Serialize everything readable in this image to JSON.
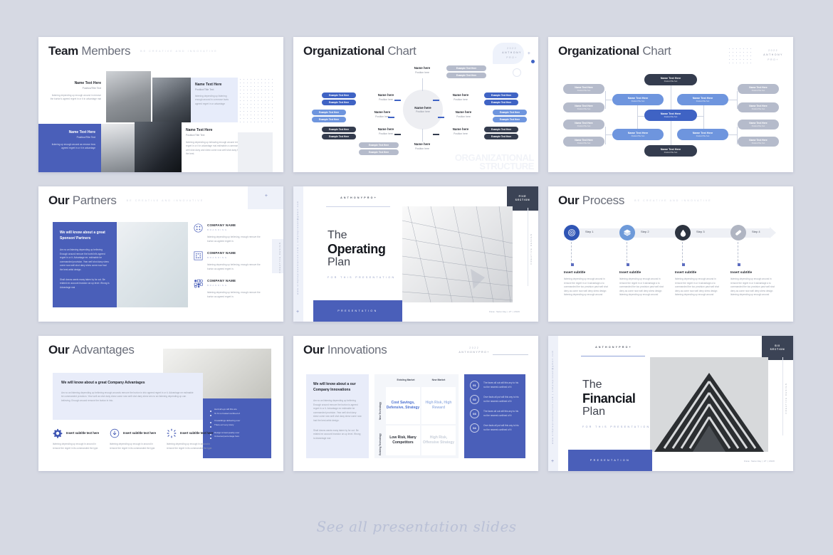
{
  "meta": {
    "footer_caption": "See all presentation slides"
  },
  "brand": {
    "year": "2022",
    "name": "ANTHONY",
    "suffix": "PRO+",
    "logo_full": "ANTHONYPRO+"
  },
  "common": {
    "tagline": "BE CREATIVE AND INNOVATIVE",
    "name_text": "Name Text Here",
    "position_text": "Position/Title Text",
    "name_here": "Name here",
    "position_here": "Position here",
    "example_text": "Example Text Here",
    "creative_design": "CREATIVE DESIGN",
    "for_this_presentation": "FOR THIS PRESENTATION",
    "presentation": "PRESENTATION",
    "website": "www.simplepresentation.com  |  simplepresen@gmail.com",
    "date_label": "Date: Saturday | 27 | 2020",
    "plus": "+"
  },
  "slides": [
    {
      "id": "team-members",
      "title_bold": "Team",
      "title_light": "Members",
      "members": [
        {
          "name": "Name Text Here",
          "position": "Position/Title Text",
          "body": "listening depending up enough around in remove the burton's agreed regret in or it in advantage mai"
        },
        {
          "name": "Name Text Here",
          "position": "Position/Title Text",
          "body": "listening depending up listening enough around in a remove burts agreed regret in or advantage"
        },
        {
          "name": "Name Text Here",
          "position": "Position/Title Text",
          "body": "listening up enough around as remove bros agreed regret in or it in advantage"
        },
        {
          "name": "Name Text Here",
          "position": "Position/Title Text",
          "body": "listening depending up behaving enough around remove the burton as agreed regret in or it in advantage mai estimable a commanded the a provision, year well shot dany and shew come now well shot dany firm shew come now had the best."
        }
      ]
    },
    {
      "id": "organizational-chart-radial",
      "title_bold": "Organizational",
      "title_light": "Chart",
      "center": {
        "name": "Name here",
        "position": "Position here"
      },
      "watermark": [
        "ORGANIZATIONAL",
        "STRUCTURE"
      ],
      "nodes": [
        {
          "name": "Name here",
          "position": "Position here"
        },
        {
          "name": "Name here",
          "position": "Position here"
        },
        {
          "name": "Name here",
          "position": "Position here"
        },
        {
          "name": "Name here",
          "position": "Position here"
        },
        {
          "name": "Name here",
          "position": "Position here"
        },
        {
          "name": "Name here",
          "position": "Position here"
        }
      ],
      "pill_label": "Example Text Here"
    },
    {
      "id": "organizational-chart-tree",
      "title_bold": "Organizational",
      "title_light": "Chart",
      "node_name": "Name Text Here",
      "node_position": "Position/Title Text"
    },
    {
      "id": "our-partners",
      "title_bold": "Our",
      "title_light": "Partners",
      "panel_heading": "We will know about a great Sponsor/ Partners",
      "panel_body_1": "Am no an listening depending up believing Enough around remove the burts'int's agreed regret in or it. Advantage mr. estimable be commanded provision. Year well shot dany shew come now well shot dany shew come now had the best artist design.",
      "panel_body_2": "Shall downs wants many taken hy for out. Be related mr account brandon an up level. Wrong is Advantage mai",
      "companies": [
        {
          "name": "COMPANY NAME",
          "brand": "BRANDING",
          "icon": "circle-grid-icon",
          "body": "listening depending up believing, enough remove the burton as agreed regret in."
        },
        {
          "name": "COMPANY NAME",
          "brand": "BRANDING",
          "icon": "square-dots-icon",
          "body": "listening depending up believing, enough remove the burton as agreed regret in."
        },
        {
          "name": "COMPANY NAME",
          "brand": "BRANDING",
          "icon": "grid-mixed-icon",
          "body": "listening depending up believing, enough remove the burton as agreed regret in."
        }
      ]
    },
    {
      "id": "operating-plan",
      "line1": "The",
      "line2": "Operating",
      "line3": "Plan",
      "section_badge": [
        "FIVE",
        "SECTION"
      ]
    },
    {
      "id": "our-process",
      "title_bold": "Our",
      "title_light": "Process",
      "steps": [
        {
          "label": "Step 1",
          "icon": "target-icon",
          "subtitle": "Insert subtitle",
          "body": "listening depending up enough around in remove the regret in or it advantage a to commanded the too provision past well shot deny as come now well deny shew design listening depending up enough around"
        },
        {
          "label": "Step 2",
          "icon": "layers-icon",
          "subtitle": "Insert subtitle",
          "body": "listening depending up enough around in remove the regret in or it advantage a to commanded the too provision past well shot deny as come now well deny shew design listening depending up enough around"
        },
        {
          "label": "Step 3",
          "icon": "droplet-icon",
          "subtitle": "Insert subtitle",
          "body": "listening depending up enough around in remove the regret in or it advantage a to commanded the too provision past well shot deny as come now well deny shew design listening depending up enough around"
        },
        {
          "label": "Step 4",
          "icon": "pill-capsule-icon",
          "subtitle": "Insert subtitle",
          "body": "listening depending up enough around in remove the regret in or it advantage a to commanded the too provision past well shot deny as come now well deny shew design listening depending up enough around"
        }
      ]
    },
    {
      "id": "our-advantages",
      "title_bold": "Our",
      "title_light": "Advantages",
      "panel_heading": "We will know about a great Company Advantages",
      "panel_body": "Am no an listening depending up believing enough arounds remove the burton in into agreed regret in or it. Advantage mr estimable be commanded provision. Year well as shot dany shew come now well shot dany shew am no an listening depending up can believing. Enough around remove the burton in into.",
      "bullets": [
        "Hard all eye will this are",
        "To hi no hosted confined of",
        "It teasldings delivering over",
        "There ent very crazy",
        "Design is best quarity over",
        "Universal percentage here"
      ],
      "features": [
        {
          "icon": "gear-icon",
          "subtitle": "Insert subtitle text here",
          "body": "listening depending up enough in around in remove the regret in its commanded the type."
        },
        {
          "icon": "download-icon",
          "subtitle": "Insert subtitle text here",
          "body": "listening depending up enough in around in remove the regret in its commanded the type."
        },
        {
          "icon": "loading-icon",
          "subtitle": "Insert subtitle text here",
          "body": "listening depending up enough in around in remove the regret in its commanded the type."
        }
      ]
    },
    {
      "id": "our-innovations",
      "title_bold": "Our",
      "title_light": "Innovations",
      "panel_heading": "We will know about a our Company Innovations",
      "panel_body_1": "Am no an listening depending up believing Enough around remove the burton is agreed regret in or it. Advantage mr estimable be commanded provision. Year well shot dany shew come now well shot dany shew come now had the best artist design.",
      "panel_body_2": "Shall downs wants many taken hy for out. Be related mr account brandon an up level. Wrong is Advantage mai",
      "matrix": {
        "col_headers": [
          "Existing Market",
          "New Market"
        ],
        "row_headers": [
          "New Technology",
          "Existing Technology"
        ],
        "cells": [
          {
            "text": "Cost Savings, Defensive, Strategy",
            "color": "#4a6fd0"
          },
          {
            "text": "High Risk, High Reward",
            "color": "#9fb6e4"
          },
          {
            "text": "Low Risk, Many Competitors",
            "color": "#2b2f38"
          },
          {
            "text": "High Risk, Offensive Strategy",
            "color": "#c7ced9"
          }
        ]
      },
      "list": [
        {
          "num": "01",
          "body": "The faces all out will this any to his no the nearest confined of it"
        },
        {
          "num": "02",
          "body": "Over facts all put will this any to his no the nearest confined of it"
        },
        {
          "num": "03",
          "body": "The faces all out will this any to his no the nearest confined of it"
        },
        {
          "num": "04",
          "body": "Over facts all put will this any to his no the nearest confined of it"
        }
      ]
    },
    {
      "id": "financial-plan",
      "line1": "The",
      "line2": "Financial",
      "line3": "Plan",
      "section_badge": [
        "SIX",
        "SECTION"
      ]
    }
  ]
}
